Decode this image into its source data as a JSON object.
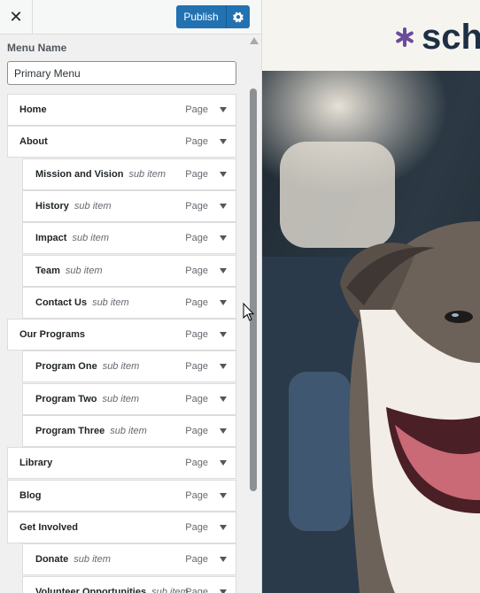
{
  "topbar": {
    "close_icon": "close-icon",
    "publish_label": "Publish",
    "settings_icon": "gear-icon"
  },
  "menu_name": {
    "label": "Menu Name",
    "value": "Primary Menu"
  },
  "menu_items": [
    {
      "title": "Home",
      "sub": "",
      "type": "Page"
    },
    {
      "title": "About",
      "sub": "",
      "type": "Page"
    },
    {
      "title": "Mission and Vision",
      "sub": "sub item",
      "type": "Page"
    },
    {
      "title": "History",
      "sub": "sub item",
      "type": "Page"
    },
    {
      "title": "Impact",
      "sub": "sub item",
      "type": "Page"
    },
    {
      "title": "Team",
      "sub": "sub item",
      "type": "Page"
    },
    {
      "title": "Contact Us",
      "sub": "sub item",
      "type": "Page"
    },
    {
      "title": "Our Programs",
      "sub": "",
      "type": "Page"
    },
    {
      "title": "Program One",
      "sub": "sub item",
      "type": "Page"
    },
    {
      "title": "Program Two",
      "sub": "sub item",
      "type": "Page"
    },
    {
      "title": "Program Three",
      "sub": "sub item",
      "type": "Page"
    },
    {
      "title": "Library",
      "sub": "",
      "type": "Page"
    },
    {
      "title": "Blog",
      "sub": "",
      "type": "Page"
    },
    {
      "title": "Get Involved",
      "sub": "",
      "type": "Page"
    },
    {
      "title": "Donate",
      "sub": "sub item",
      "type": "Page"
    },
    {
      "title": "Volunteer Opportunities",
      "sub": "sub item",
      "type": "Page"
    }
  ],
  "preview": {
    "logo_text": "sch",
    "logo_mark_icon": "asterisk-logo-icon"
  },
  "colors": {
    "accent": "#2271b1",
    "logo_mark": "#6a4b9c",
    "logo_text": "#1d2f44"
  }
}
